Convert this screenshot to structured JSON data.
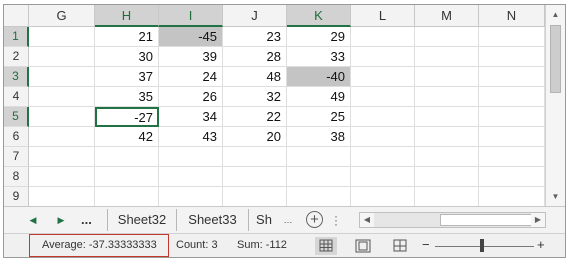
{
  "columns": [
    "G",
    "H",
    "I",
    "J",
    "K",
    "L",
    "M",
    "N"
  ],
  "rows": [
    "1",
    "2",
    "3",
    "4",
    "5",
    "6",
    "7",
    "8",
    "9"
  ],
  "cells": {
    "H": [
      "21",
      "30",
      "37",
      "35",
      "-27",
      "42",
      "",
      "",
      ""
    ],
    "I": [
      "-45",
      "39",
      "24",
      "26",
      "34",
      "43",
      "",
      "",
      ""
    ],
    "J": [
      "23",
      "28",
      "48",
      "32",
      "22",
      "20",
      "",
      "",
      ""
    ],
    "K": [
      "29",
      "33",
      "-40",
      "49",
      "25",
      "38",
      "",
      "",
      ""
    ]
  },
  "selection": {
    "highlighted": [
      "I1",
      "K3"
    ],
    "active": "H5",
    "selected_columns": [
      "H",
      "I",
      "K"
    ],
    "selected_rows": [
      "1",
      "3",
      "5"
    ]
  },
  "sheet_tabs": {
    "ellipsis": "...",
    "tabs": [
      "Sheet32",
      "Sheet33",
      "Sh"
    ],
    "add_label": "+"
  },
  "status_bar": {
    "average": "Average: -37.33333333",
    "count": "Count: 3",
    "sum": "Sum: -112",
    "zoom_minus": "−",
    "zoom_plus": "+"
  },
  "colors": {
    "accent": "#217346",
    "selection_fill": "#c4c4c4",
    "callout_border": "#c0392b"
  }
}
